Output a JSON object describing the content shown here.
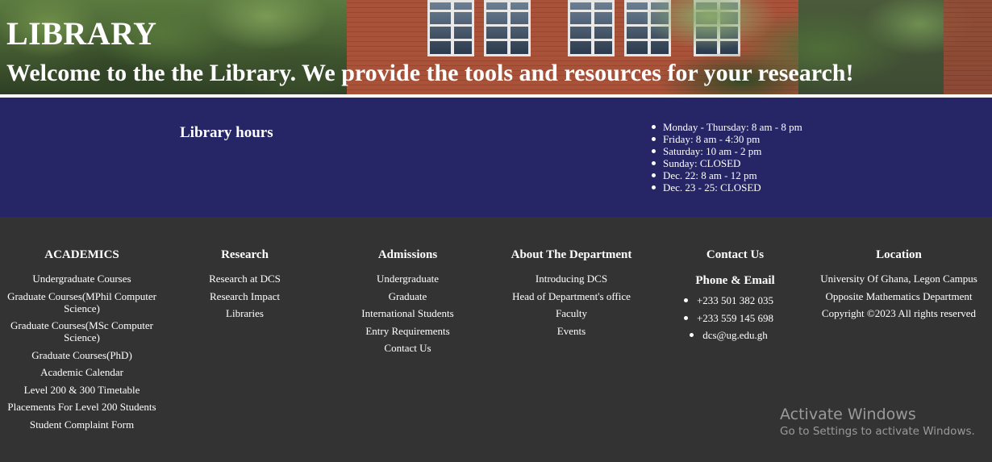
{
  "hero": {
    "title": "LIBRARY",
    "subtitle": "Welcome to the the Library. We provide the tools and resources for your research!"
  },
  "hours": {
    "title": "Library hours",
    "items": [
      "Monday - Thursday: 8 am - 8 pm",
      "Friday: 8 am - 4:30 pm",
      "Saturday: 10 am - 2 pm",
      "Sunday: CLOSED",
      "Dec. 22: 8 am - 12 pm",
      "Dec. 23 - 25: CLOSED"
    ]
  },
  "footer": {
    "academics": {
      "heading": "ACADEMICS",
      "links": [
        "Undergraduate Courses",
        "Graduate Courses(MPhil Computer Science)",
        "Graduate Courses(MSc Computer Science)",
        "Graduate Courses(PhD)",
        "Academic Calendar",
        "Level 200 & 300 Timetable",
        "Placements For Level 200 Students",
        "Student Complaint Form"
      ]
    },
    "research": {
      "heading": "Research",
      "links": [
        "Research at DCS",
        "Research Impact",
        "Libraries"
      ]
    },
    "admissions": {
      "heading": "Admissions",
      "links": [
        "Undergraduate",
        "Graduate",
        "International Students",
        "Entry Requirements",
        "Contact Us"
      ]
    },
    "about": {
      "heading": "About The Department",
      "links": [
        "Introducing DCS",
        "Head of Department's office",
        "Faculty",
        "Events"
      ]
    },
    "contact": {
      "heading": "Contact Us",
      "subheading": "Phone & Email",
      "items": [
        "+233 501 382 035",
        "+233 559 145 698",
        "dcs@ug.edu.gh"
      ]
    },
    "location": {
      "heading": "Location",
      "lines": [
        "University Of Ghana, Legon Campus",
        "Opposite Mathematics Department",
        "Copyright ©2023 All rights reserved"
      ]
    }
  },
  "watermark": {
    "line1": "Activate Windows",
    "line2": "Go to Settings to activate Windows."
  }
}
